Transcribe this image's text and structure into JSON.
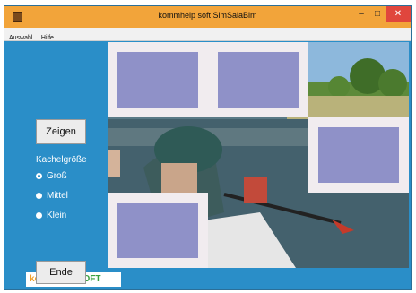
{
  "window": {
    "title": "kommhelp soft SimSalaBim"
  },
  "window_controls": {
    "minimize": "–",
    "maximize": "□",
    "close": "✕"
  },
  "menu": {
    "items": [
      "Auswahl",
      "Hilfe"
    ]
  },
  "buttons": {
    "show": "Zeigen",
    "end": "Ende"
  },
  "tile_size": {
    "label": "Kachelgröße",
    "options": [
      {
        "label": "Groß",
        "checked": true
      },
      {
        "label": "Mittel",
        "checked": false
      },
      {
        "label": "Klein",
        "checked": false
      }
    ]
  },
  "logo": {
    "part1": "kommhelp",
    "part2": "SOFT"
  },
  "colors": {
    "background": "#2a8ec8",
    "titlebar": "#f2a43a",
    "tile": "#8f91c8",
    "tile_frame": "#f1ecef",
    "close": "#e0463d"
  },
  "icons": {
    "app": "app-icon"
  }
}
